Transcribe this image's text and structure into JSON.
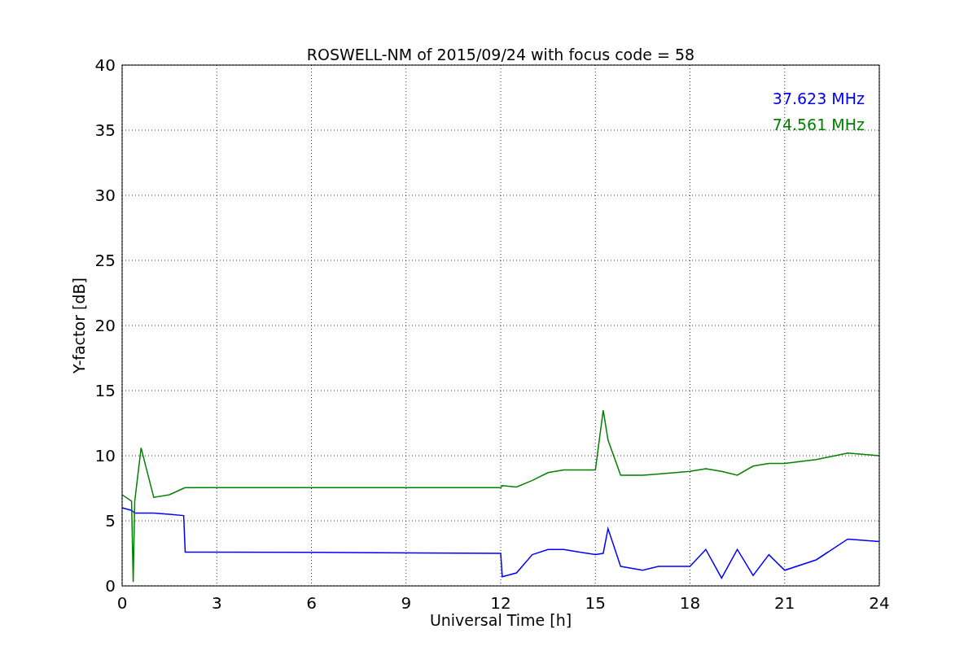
{
  "chart_data": {
    "type": "line",
    "title": "ROSWELL-NM of 2015/09/24 with focus code = 58",
    "xlabel": "Universal Time [h]",
    "ylabel": "Y-factor [dB]",
    "x": [
      0,
      0.3,
      0.35,
      0.4,
      0.6,
      1,
      1.5,
      1.95,
      2,
      6,
      12,
      12.05,
      12.5,
      13,
      13.5,
      14,
      14.5,
      15,
      15.25,
      15.4,
      15.8,
      16.5,
      17,
      18,
      18.5,
      19,
      19.5,
      20,
      20.5,
      21,
      22,
      23,
      24
    ],
    "series": [
      {
        "name": "37.623 MHz",
        "color": "#0000ff",
        "values": [
          6,
          5.8,
          5.7,
          5.6,
          5.6,
          5.6,
          5.5,
          5.4,
          2.6,
          2.58,
          2.5,
          0.7,
          1.0,
          2.4,
          2.8,
          2.8,
          2.6,
          2.4,
          2.5,
          4.4,
          1.5,
          1.2,
          1.5,
          1.5,
          2.8,
          0.6,
          2.8,
          0.8,
          2.4,
          1.2,
          2.0,
          3.6,
          3.4
        ]
      },
      {
        "name": "74.561 MHz",
        "color": "#008000",
        "values": [
          7,
          6.5,
          0.3,
          6.5,
          10.6,
          6.8,
          7,
          7.5,
          7.55,
          7.55,
          7.55,
          7.7,
          7.6,
          8.1,
          8.7,
          8.9,
          8.9,
          8.9,
          13.5,
          11.2,
          8.5,
          8.5,
          8.6,
          8.8,
          9,
          8.8,
          8.5,
          9.2,
          9.4,
          9.4,
          9.7,
          10.2,
          10
        ]
      }
    ],
    "xlim": [
      0,
      24
    ],
    "ylim": [
      0,
      40
    ],
    "xticks": [
      0,
      3,
      6,
      9,
      12,
      15,
      18,
      21,
      24
    ],
    "yticks": [
      0,
      5,
      10,
      15,
      20,
      25,
      30,
      35,
      40
    ],
    "grid": true
  }
}
